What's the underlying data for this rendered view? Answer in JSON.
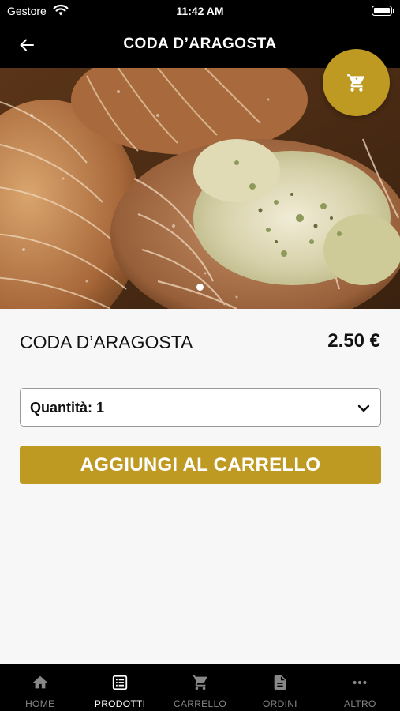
{
  "status_bar": {
    "carrier": "Gestore",
    "time": "11:42 AM"
  },
  "header": {
    "title": "CODA D’ARAGOSTA",
    "back_icon": "arrow-left-icon"
  },
  "cart_fab": {
    "icon": "shopping-cart-icon"
  },
  "carousel": {
    "total": 1,
    "current": 1
  },
  "product": {
    "name": "CODA D’ARAGOSTA",
    "price": "2.50 €"
  },
  "quantity": {
    "label": "Quantità: 1",
    "selected": 1
  },
  "add_button": {
    "label": "AGGIUNGI AL CARRELLO"
  },
  "tabs": [
    {
      "label": "HOME",
      "icon": "home-icon",
      "active": false
    },
    {
      "label": "PRODOTTI",
      "icon": "list-icon",
      "active": true
    },
    {
      "label": "CARRELLO",
      "icon": "cart-icon",
      "active": false
    },
    {
      "label": "ORDINI",
      "icon": "document-icon",
      "active": false
    },
    {
      "label": "ALTRO",
      "icon": "more-icon",
      "active": false
    }
  ],
  "colors": {
    "accent": "#bf9a22",
    "bar_background": "#000000",
    "page_background": "#f7f7f7"
  }
}
